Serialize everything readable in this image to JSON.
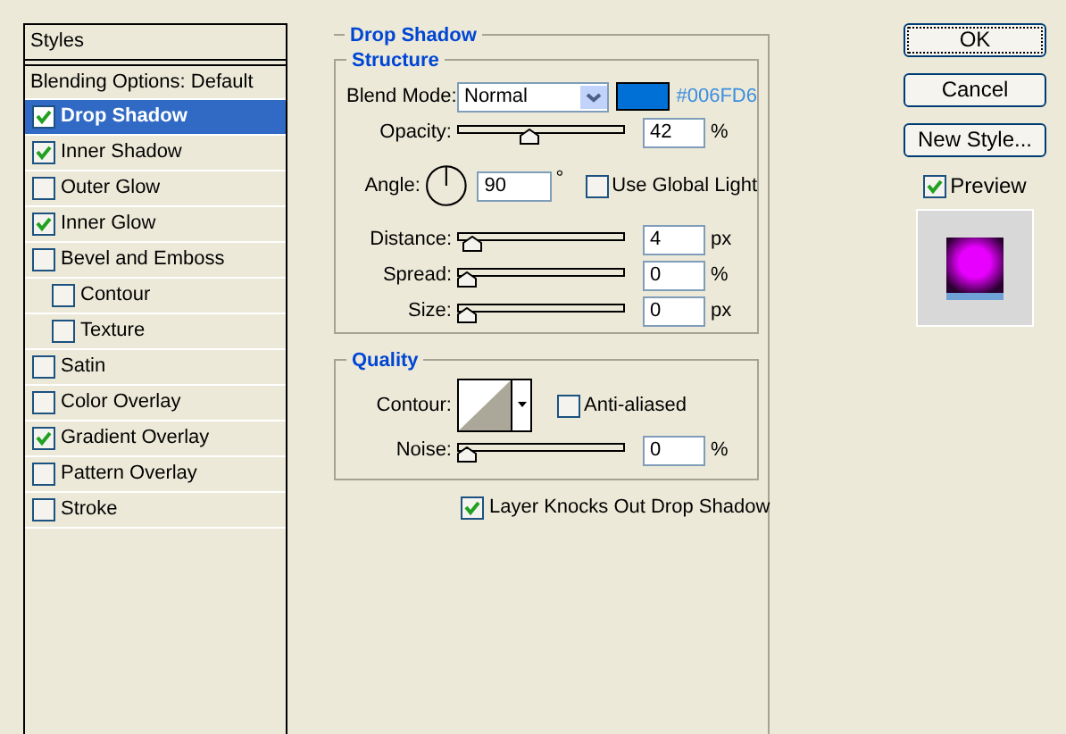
{
  "styles_panel": {
    "header": "Styles",
    "items": [
      {
        "label": "Blending Options: Default",
        "kind": "plain",
        "selected": false
      },
      {
        "label": "Drop Shadow",
        "kind": "effect",
        "checked": true,
        "selected": true
      },
      {
        "label": "Inner Shadow",
        "kind": "effect",
        "checked": true,
        "selected": false
      },
      {
        "label": "Outer Glow",
        "kind": "effect",
        "checked": false,
        "selected": false
      },
      {
        "label": "Inner Glow",
        "kind": "effect",
        "checked": true,
        "selected": false
      },
      {
        "label": "Bevel and Emboss",
        "kind": "effect",
        "checked": false,
        "selected": false,
        "children": [
          {
            "label": "Contour",
            "kind": "effect",
            "checked": false,
            "selected": false
          },
          {
            "label": "Texture",
            "kind": "effect",
            "checked": false,
            "selected": false
          }
        ]
      },
      {
        "label": "Satin",
        "kind": "effect",
        "checked": false,
        "selected": false
      },
      {
        "label": "Color Overlay",
        "kind": "effect",
        "checked": false,
        "selected": false
      },
      {
        "label": "Gradient Overlay",
        "kind": "effect",
        "checked": true,
        "selected": false
      },
      {
        "label": "Pattern Overlay",
        "kind": "effect",
        "checked": false,
        "selected": false
      },
      {
        "label": "Stroke",
        "kind": "effect",
        "checked": false,
        "selected": false
      }
    ]
  },
  "drop_shadow": {
    "title": "Drop Shadow",
    "structure": {
      "title": "Structure",
      "blend_mode": {
        "label": "Blend Mode:",
        "value": "Normal"
      },
      "color": {
        "hex": "#006FD6"
      },
      "opacity": {
        "label": "Opacity:",
        "level": 0.42,
        "value": "42",
        "unit": "%"
      },
      "angle": {
        "label": "Angle:",
        "value": "90",
        "unit": "°"
      },
      "global_light": {
        "label": "Use Global Light",
        "checked": false
      },
      "sliders": [
        {
          "label": "Distance:",
          "level": 0.04,
          "value": "4",
          "unit": "px"
        },
        {
          "label": "Spread:",
          "level": 0,
          "value": "0",
          "unit": "%"
        },
        {
          "label": "Size:",
          "level": 0,
          "value": "0",
          "unit": "px"
        }
      ]
    },
    "quality": {
      "title": "Quality",
      "contour_label": "Contour:",
      "anti_aliased": {
        "label": "Anti-aliased",
        "checked": false
      },
      "noise": {
        "label": "Noise:",
        "level": 0,
        "value": "0",
        "unit": "%"
      }
    },
    "knocks_out": {
      "label": "Layer Knocks Out Drop Shadow",
      "checked": true
    }
  },
  "buttons": [
    {
      "label": "OK",
      "default": true
    },
    {
      "label": "Cancel",
      "default": false
    },
    {
      "label": "New Style...",
      "default": false
    }
  ],
  "preview": {
    "label": "Preview",
    "checked": true
  }
}
